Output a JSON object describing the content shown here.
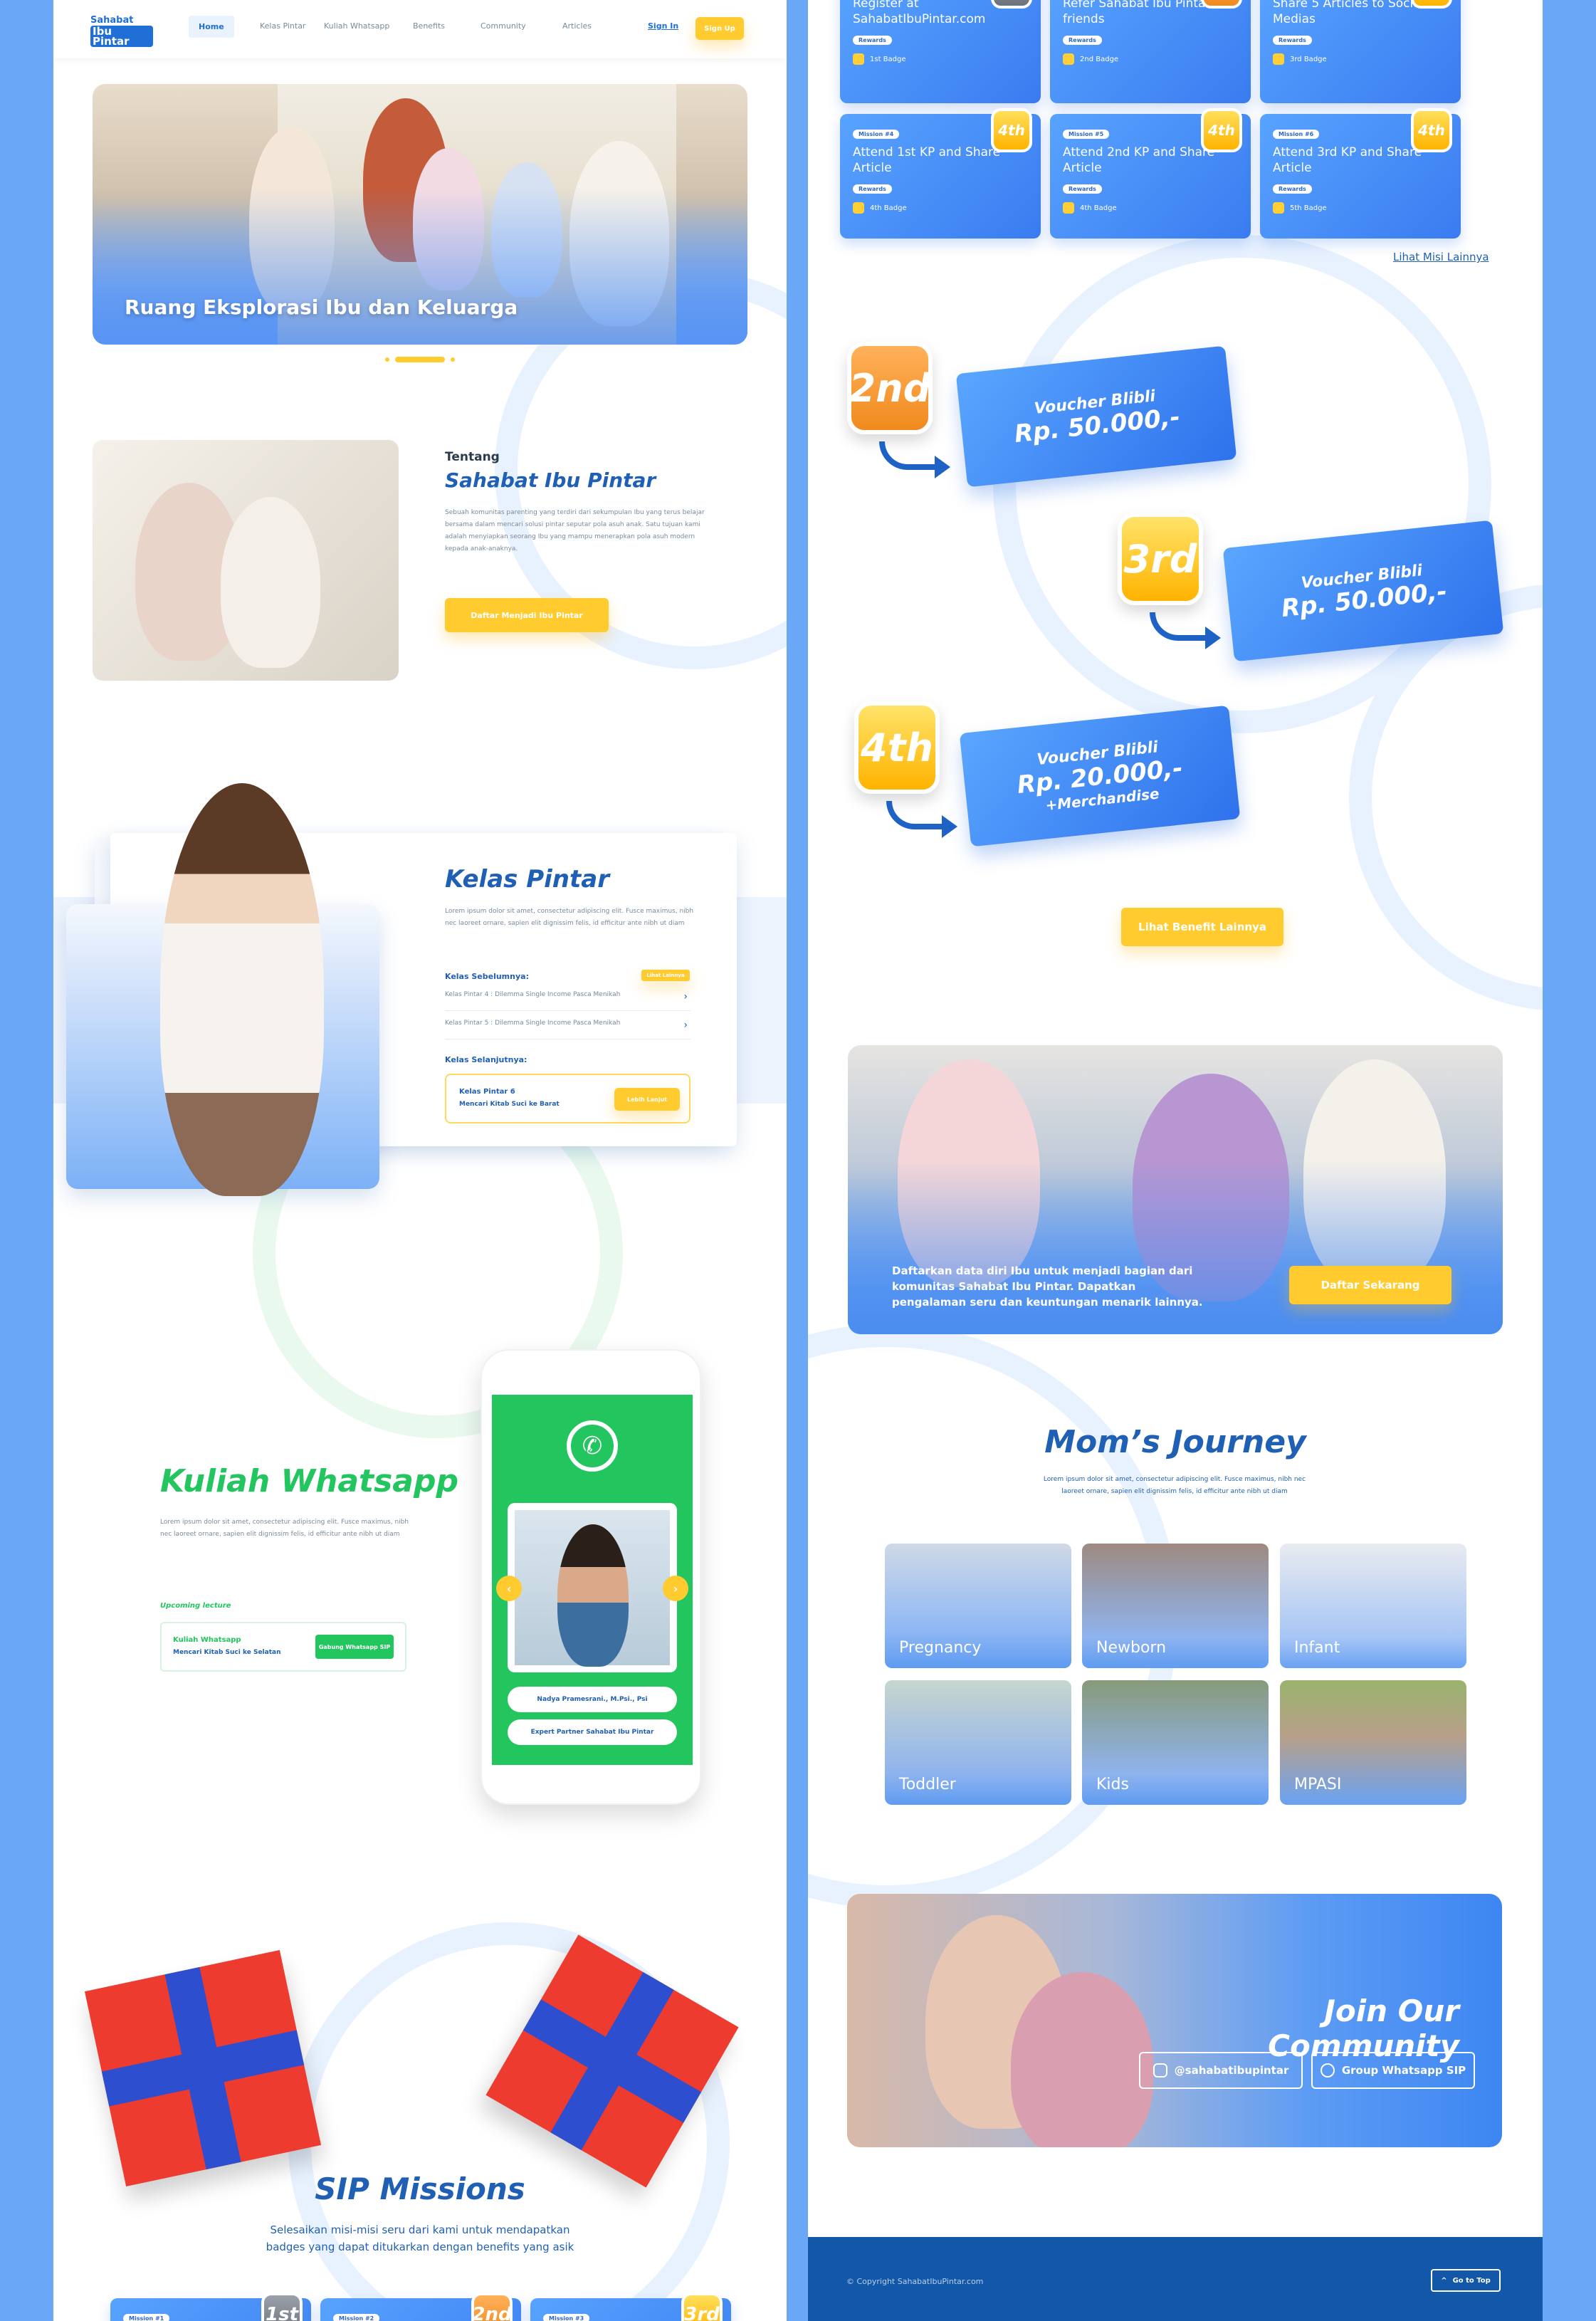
{
  "nav": {
    "logo_line1": "Sahabat",
    "logo_line2": "Ibu Pintar",
    "items": [
      "Home",
      "Kelas Pintar",
      "Kuliah Whatsapp",
      "Benefits",
      "Community",
      "Articles"
    ],
    "signin": "Sign In",
    "signup": "Sign Up"
  },
  "hero": {
    "title": "Ruang Eksplorasi Ibu dan Keluarga"
  },
  "about": {
    "eyebrow": "Tentang",
    "title": "Sahabat Ibu Pintar",
    "text": "Sebuah komunitas parenting yang terdiri dari sekumpulan Ibu yang terus belajar bersama dalam mencari solusi pintar seputar pola asuh anak. Satu tujuan kami adalah menyiapkan seorang Ibu yang mampu menerapkan pola asuh modern kepada anak-anaknya.",
    "button": "Daftar Menjadi Ibu Pintar"
  },
  "kelas": {
    "title": "Kelas Pintar",
    "text": "Lorem ipsum dolor sit amet, consectetur adipiscing elit. Fusce maximus, nibh nec laoreet ornare, sapien elit dignissim felis, id efficitur ante nibh ut diam",
    "prev_label": "Kelas Sebelumnya:",
    "see_all": "Lihat Lainnya",
    "prev_items": [
      "Kelas Pintar 4 : Dilemma Single Income Pasca Menikah",
      "Kelas Pintar 5 : Dilemma Single Income Pasca Menikah"
    ],
    "next_label": "Kelas Selanjutnya:",
    "next_title": "Kelas Pintar 6",
    "next_sub": "Mencari Kitab Suci ke Barat",
    "next_button": "Lebih Lanjut"
  },
  "kuliah": {
    "title": "Kuliah Whatsapp",
    "text": "Lorem ipsum dolor sit amet, consectetur adipiscing elit. Fusce maximus, nibh nec laoreet ornare, sapien elit dignissim felis, id efficitur ante nibh ut diam",
    "upcoming": "Upcoming lecture",
    "card_title": "Kuliah Whatsapp",
    "card_sub": "Mencari Kitab Suci ke Selatan",
    "card_button": "Gabung Whatsapp SIP",
    "speaker": "Nadya Pramesrani., M.Psi., Psi",
    "role": "Expert Partner Sahabat Ibu Pintar"
  },
  "missions": {
    "title": "SIP Missions",
    "text": "Selesaikan misi-misi seru dari kami untuk mendapatkan badges yang dapat ditukarkan dengan benefits yang asik",
    "bottom_tags": [
      "Mission #1",
      "Mission #2",
      "Mission #3"
    ],
    "bottom_medals": [
      "1st",
      "2nd",
      "3rd"
    ],
    "top_row": [
      {
        "title": "Register at SahabatIbuPintar.com",
        "badge": "1st Badge",
        "medal": "1"
      },
      {
        "title": "Refer Sahabat Ibu Pintar to friends",
        "badge": "2nd Badge",
        "medal": "2"
      },
      {
        "title": "Share 5 Articles to Social Medias",
        "badge": "3rd Badge",
        "medal": "3"
      }
    ],
    "row2": [
      {
        "tag": "Mission #4",
        "title": "Attend 1st KP and Share Article",
        "badge": "4th Badge",
        "medal": "4th"
      },
      {
        "tag": "Mission #5",
        "title": "Attend 2nd KP and Share Article",
        "badge": "4th Badge",
        "medal": "4th"
      },
      {
        "tag": "Mission #6",
        "title": "Attend 3rd KP and Share Article",
        "badge": "5th Badge",
        "medal": "4th"
      }
    ],
    "rewards": "Rewards",
    "more": "Lihat Misi Lainnya"
  },
  "benefits": {
    "vouchers": [
      {
        "badge": "2nd",
        "l1": "Voucher Blibli",
        "l2": "Rp. 50.000,-",
        "l3": ""
      },
      {
        "badge": "3rd",
        "l1": "Voucher Blibli",
        "l2": "Rp. 50.000,-",
        "l3": ""
      },
      {
        "badge": "4th",
        "l1": "Voucher Blibli",
        "l2": "Rp. 20.000,-",
        "l3": "+Merchandise"
      }
    ],
    "button": "Lihat Benefit Lainnya"
  },
  "register": {
    "text": "Daftarkan data diri Ibu untuk menjadi bagian dari komunitas Sahabat Ibu Pintar. Dapatkan pengalaman seru dan keuntungan menarik lainnya.",
    "button": "Daftar Sekarang"
  },
  "journey": {
    "title": "Mom’s Journey",
    "text": "Lorem ipsum dolor sit amet, consectetur adipiscing elit. Fusce maximus, nibh nec laoreet ornare, sapien elit dignissim felis, id efficitur ante nibh ut diam",
    "tiles": [
      "Pregnancy",
      "Newborn",
      "Infant",
      "Toddler",
      "Kids",
      "MPASI"
    ]
  },
  "community": {
    "title": "Join Our Community",
    "instagram": "@sahabatibupintar",
    "whatsapp": "Group Whatsapp SIP"
  },
  "footer": {
    "copyright": "© Copyright SahabatIbuPintar.com",
    "top": "Go to Top"
  },
  "colors": {
    "primary": "#1f6fd6",
    "accent": "#ffcb2f",
    "whatsapp": "#22c55e",
    "bg": "#6aa8f7"
  }
}
